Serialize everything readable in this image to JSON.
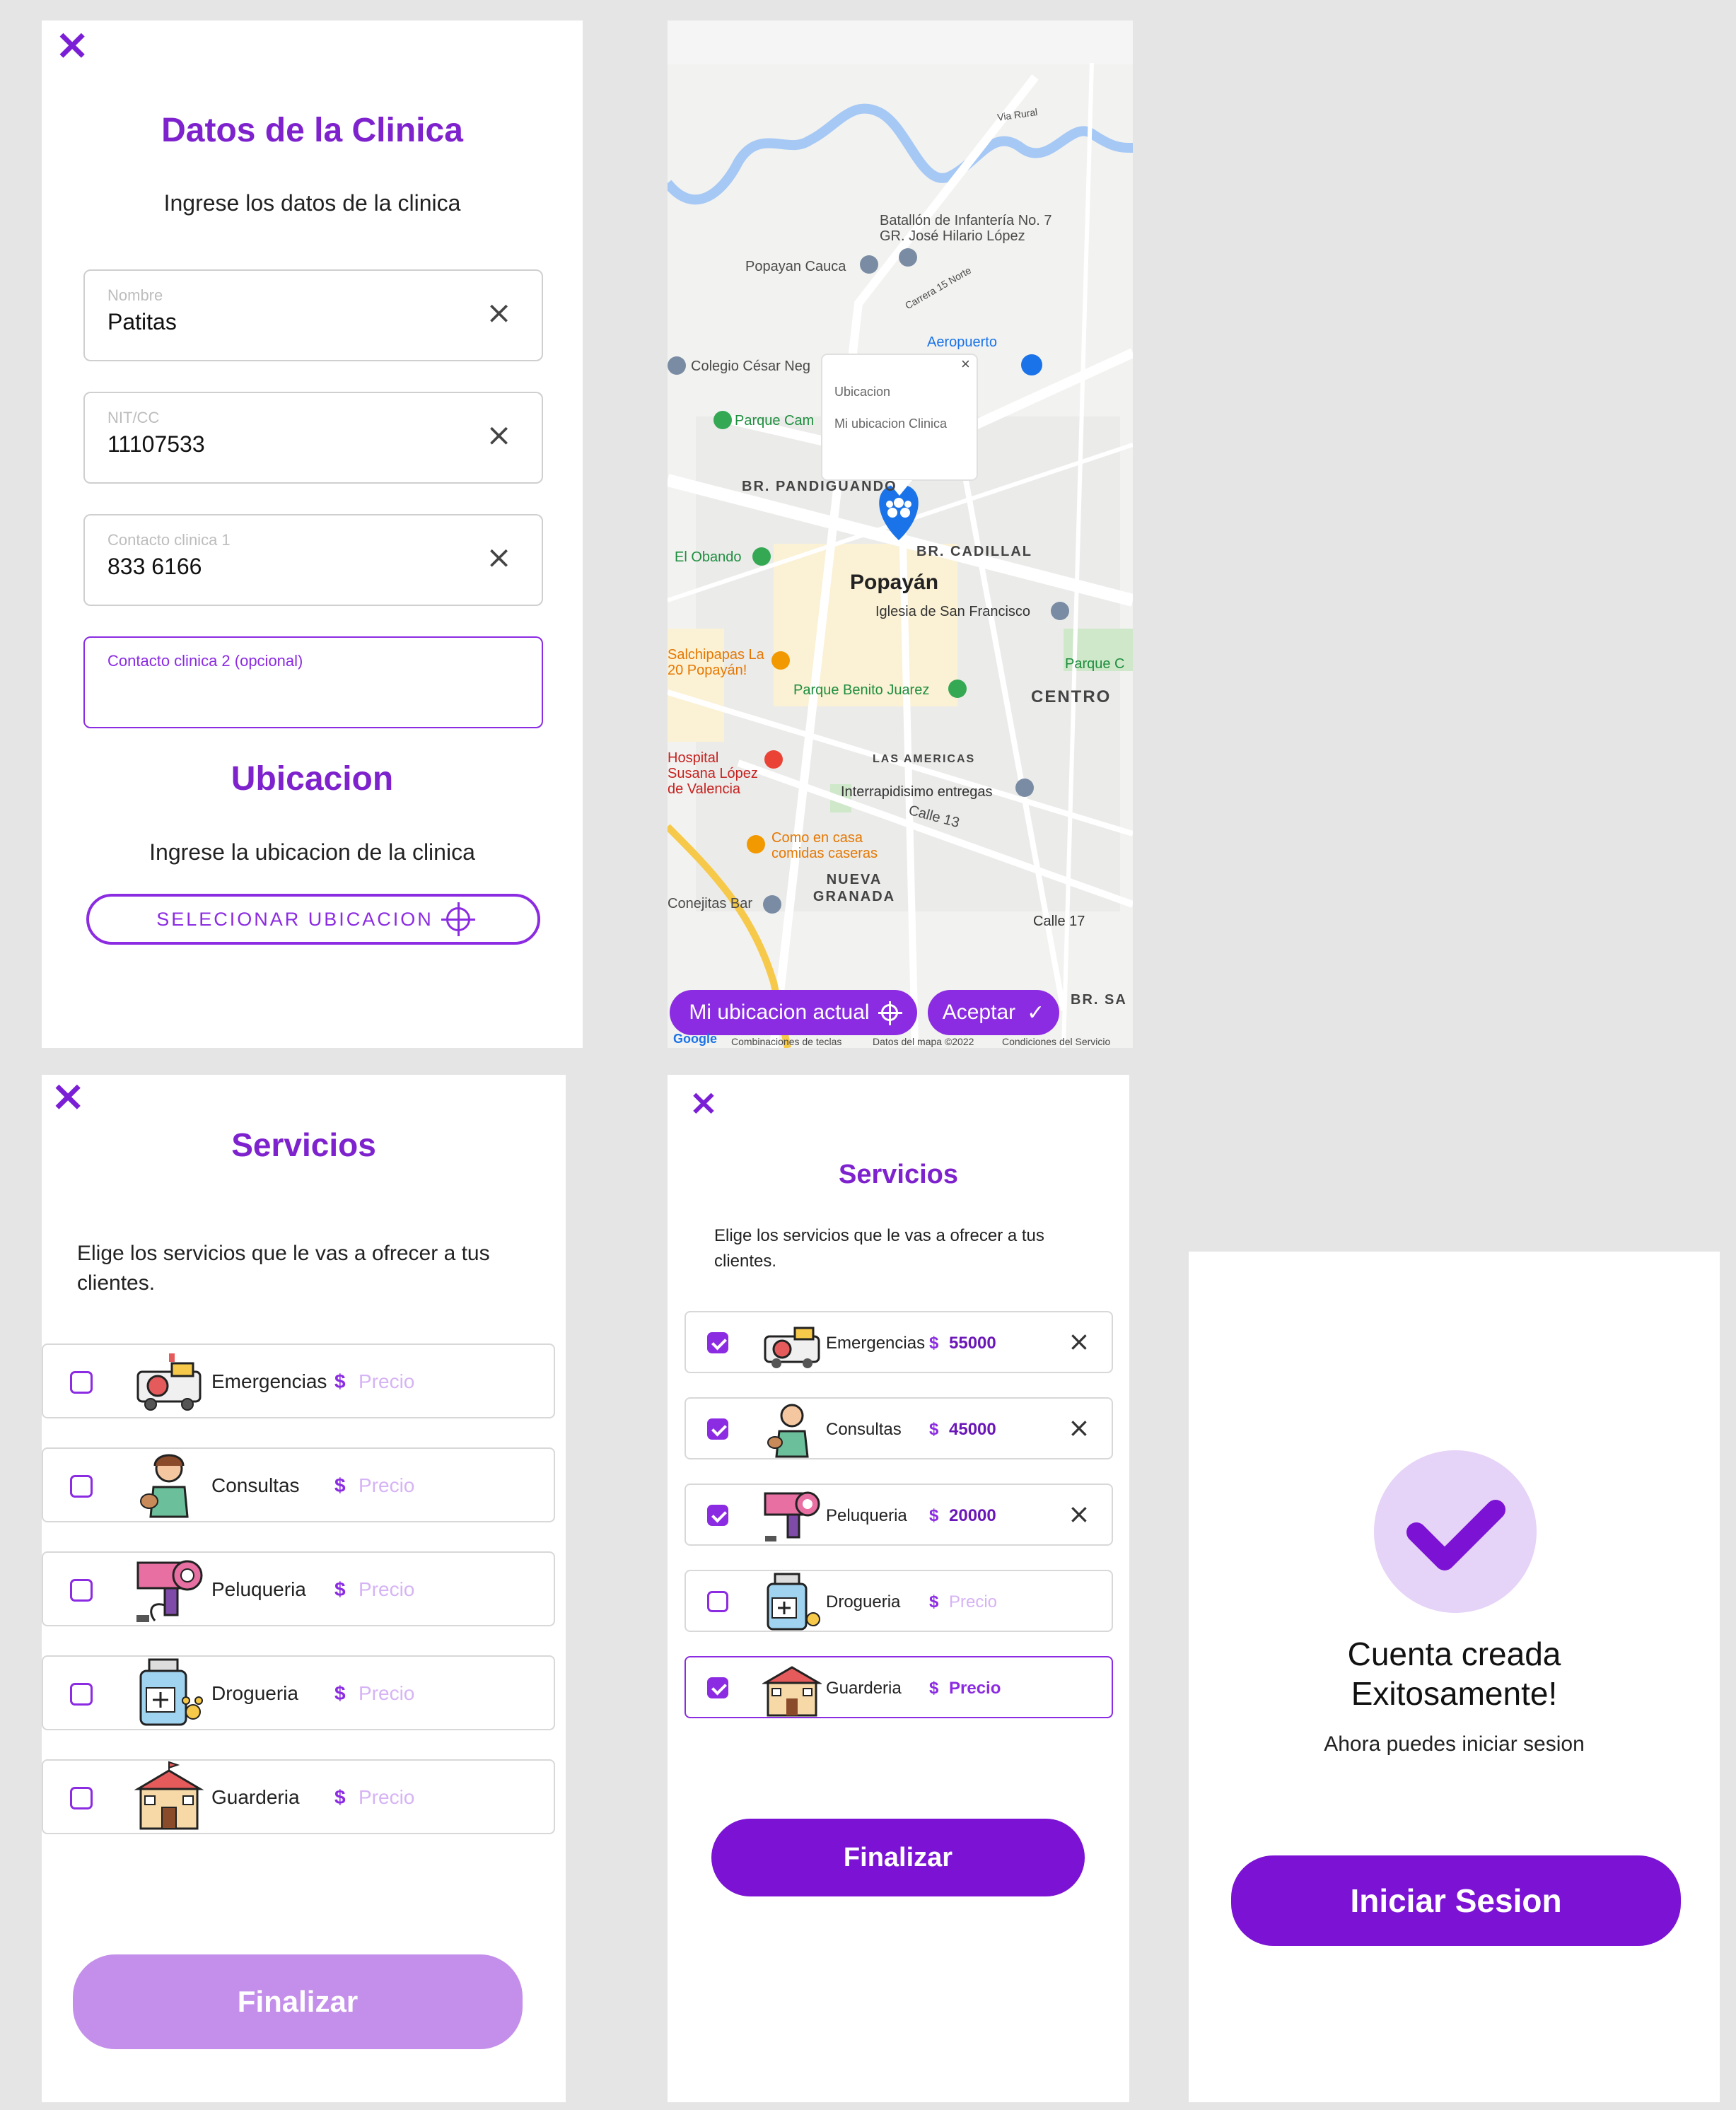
{
  "clinic_form": {
    "close_icon": "×",
    "title": "Datos de la Clinica",
    "subtitle": "Ingrese los datos de la clinica",
    "fields": [
      {
        "label": "Nombre",
        "value": "Patitas"
      },
      {
        "label": "NIT/CC",
        "value": "11107533"
      },
      {
        "label": "Contacto clinica 1",
        "value": "833 6166"
      },
      {
        "label": "Contacto clinica 2 (opcional)",
        "value": ""
      }
    ],
    "clear_icon": "×",
    "location_title": "Ubicacion",
    "location_subtitle": "Ingrese la ubicacion de la clinica",
    "select_location_button": "SELECIONAR UBICACION"
  },
  "map": {
    "popup_title": "Ubicacion",
    "popup_text": "Mi ubicacion Clinica",
    "popup_close": "×",
    "labels": {
      "via_rural": "Via Rural",
      "batallon": "Batallón de Infantería No. 7 GR. José Hilario López",
      "popayan_cauca": "Popayan Cauca",
      "carrera15": "Carrera 15 Norte",
      "aeropuerto": "Aeropuerto",
      "colegio": "Colegio César Neg",
      "parque_cam": "Parque Cam",
      "pandiguando": "BR. PANDIGUANDO",
      "el_obando": "El Obando",
      "cadillal": "BR. CADILLAL",
      "popayan": "Popayán",
      "iglesia": "Iglesia de San Francisco",
      "salchipapas": "Salchipapas La 20 Popayán!",
      "parque_benito": "Parque Benito Juarez",
      "centro": "CENTRO",
      "hospital": "Hospital Susana López de Valencia",
      "las_americas": "LAS AMERICAS",
      "interrapidisimo": "Interrapidisimo entregas",
      "calle13": "Calle 13",
      "como_en_casa": "Como en casa comidas caseras",
      "nueva_granada": "NUEVA GRANADA",
      "conejitas": "Conejitas Bar",
      "calle17": "Calle 17",
      "br_sa": "BR. SA",
      "parque_c": "Parque C",
      "google": "Google",
      "footer_keys": "Combinaciones de teclas",
      "footer_data": "Datos del mapa ©2022",
      "footer_terms": "Condiciones del Servicio"
    },
    "my_location_button": "Mi ubicacion actual",
    "accept_button": "Aceptar",
    "accept_check": "✓"
  },
  "services_empty": {
    "close_icon": "×",
    "title": "Servicios",
    "subtitle": "Elige los servicios que le vas a ofrecer a tus clientes.",
    "currency": "$",
    "price_placeholder": "Precio",
    "items": [
      {
        "name": "Emergencias",
        "icon": "ambulance-icon"
      },
      {
        "name": "Consultas",
        "icon": "veterinarian-icon"
      },
      {
        "name": "Peluqueria",
        "icon": "hair-dryer-icon"
      },
      {
        "name": "Drogueria",
        "icon": "medicine-bottle-icon"
      },
      {
        "name": "Guarderia",
        "icon": "daycare-building-icon"
      }
    ],
    "finish_button": "Finalizar"
  },
  "services_filled": {
    "close_icon": "×",
    "title": "Servicios",
    "subtitle": "Elige los servicios que le vas a ofrecer a tus clientes.",
    "currency": "$",
    "items": [
      {
        "name": "Emergencias",
        "price": "55000",
        "checked": true
      },
      {
        "name": "Consultas",
        "price": "45000",
        "checked": true
      },
      {
        "name": "Peluqueria",
        "price": "20000",
        "checked": true
      },
      {
        "name": "Drogueria",
        "price": "Precio",
        "checked": false
      },
      {
        "name": "Guarderia",
        "price": "Precio",
        "checked": true
      }
    ],
    "remove_icon": "×",
    "finish_button": "Finalizar"
  },
  "success": {
    "title_line1": "Cuenta creada",
    "title_line2": "Exitosamente!",
    "subtitle": "Ahora puedes iniciar sesion",
    "login_button": "Iniciar Sesion"
  },
  "colors": {
    "accent": "#8b2be2",
    "title": "#7e22ce",
    "disabled_button": "#c48fea",
    "success_circle": "#e6d3f8",
    "background": "#e5e5e5"
  }
}
